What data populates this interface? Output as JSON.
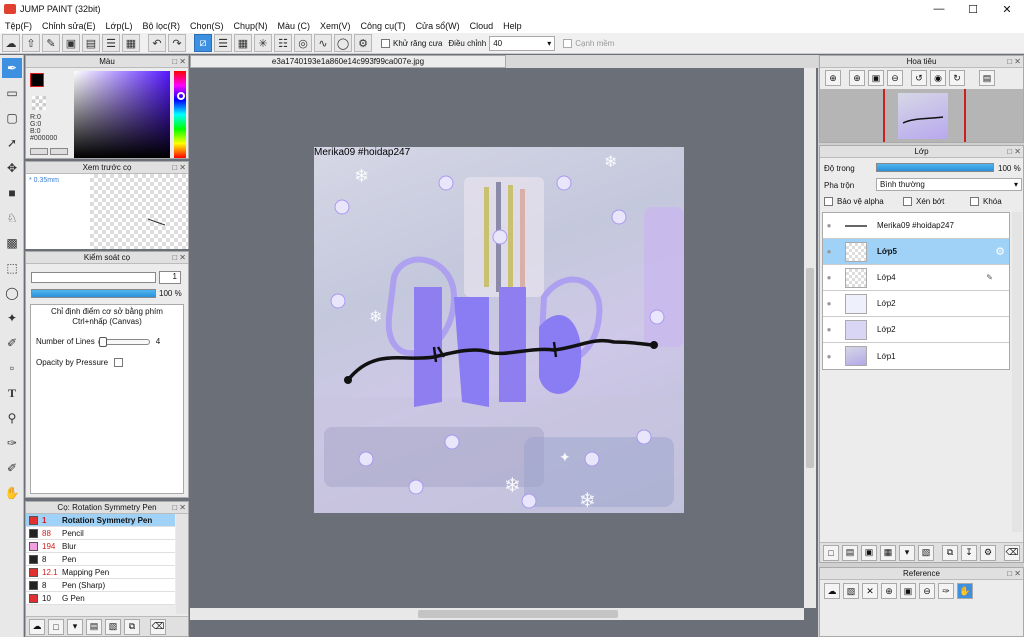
{
  "window": {
    "title": "JUMP PAINT (32bit)"
  },
  "menu": [
    "Tệp(F)",
    "Chỉnh sửa(E)",
    "Lớp(L)",
    "Bộ lọc(R)",
    "Chọn(S)",
    "Chụp(N)",
    "Màu (C)",
    "Xem(V)",
    "Công cụ(T)",
    "Cửa sổ(W)",
    "Cloud",
    "Help"
  ],
  "toolbar": {
    "antialias_label": "Khử răng cưa",
    "adjust_label": "Điều chỉnh",
    "adjust_value": "40",
    "edge_label": "Cạnh mềm"
  },
  "color_panel": {
    "title": "Màu",
    "r": "R:0",
    "g": "G:0",
    "b": "B:0",
    "hex": "#000000",
    "accent": "#3d8fe0"
  },
  "brush_preview": {
    "title": "Xem trước cọ",
    "size": "* 0.35mm"
  },
  "brush_control": {
    "title": "Kiểm soát cọ",
    "size_value": "1",
    "opacity_value": "100 %",
    "description": "Chỉ định điểm cơ sở bằng phím Ctrl+nhấp (Canvas)",
    "lines_label": "Number of Lines",
    "lines_value": "4",
    "pressure_label": "Opacity by Pressure"
  },
  "brush_list": {
    "title": "Cọ: Rotation Symmetry Pen",
    "items": [
      {
        "size": "1",
        "name": "Rotation Symmetry Pen",
        "color": "#e03030"
      },
      {
        "size": "88",
        "name": "Pencil",
        "color": "#222222"
      },
      {
        "size": "194",
        "name": "Blur",
        "color": "#f0a0e0"
      },
      {
        "size": "8",
        "name": "Pen",
        "color": "#222222"
      },
      {
        "size": "12.1",
        "name": "Mapping Pen",
        "color": "#e03030"
      },
      {
        "size": "8",
        "name": "Pen (Sharp)",
        "color": "#222222"
      },
      {
        "size": "10",
        "name": "G Pen",
        "color": "#e03030"
      }
    ]
  },
  "canvas": {
    "tab_title": "e3a1740193e1a860e14c993f99ca007e.jpg",
    "watermark": "Merika09 #hoidap247"
  },
  "navigator": {
    "title": "Hoa tiêu"
  },
  "layers": {
    "title": "Lớp",
    "opacity_label": "Độ trong",
    "opacity_value": "100 %",
    "blend_label": "Pha trộn",
    "blend_value": "Bình thường",
    "protect_alpha": "Bảo vệ alpha",
    "clipping": "Xén bớt",
    "lock": "Khóa",
    "items": [
      {
        "name": "Merika09 #hoidap247"
      },
      {
        "name": "Lớp5"
      },
      {
        "name": "Lớp4"
      },
      {
        "name": "Lớp2"
      },
      {
        "name": "Lớp2"
      },
      {
        "name": "Lớp1"
      }
    ]
  },
  "reference": {
    "title": "Reference"
  }
}
